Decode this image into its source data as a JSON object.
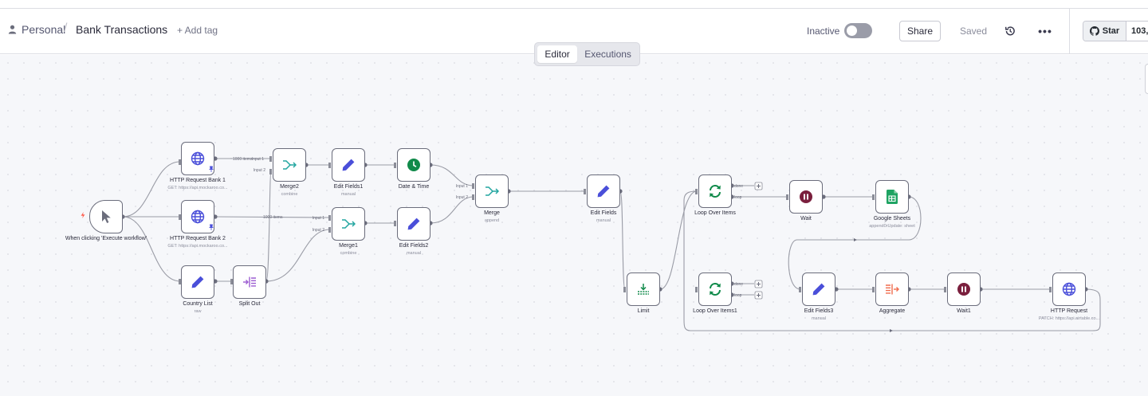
{
  "header": {
    "breadcrumb_personal": "Personal",
    "breadcrumb_sep": "/",
    "workflow_title": "Bank Transactions",
    "add_tag": "+ Add tag",
    "status_label": "Inactive",
    "share_label": "Share",
    "saved_label": "Saved",
    "more_label": "•••",
    "github_star_label": "Star",
    "github_star_count": "103,"
  },
  "tabs": {
    "editor": "Editor",
    "executions": "Executions"
  },
  "colors": {
    "accent_blue": "#4a4fd9",
    "teal": "#23a6a0",
    "green": "#108a4a",
    "sheets_green": "#1ea362",
    "wait_red": "#7a1f3d",
    "aggregate_orange": "#f06b4d",
    "split_purple": "#9b5bd0",
    "trigger_red": "#ff5a4a"
  },
  "nodes": {
    "trigger": {
      "label": "When clicking 'Execute workflow'",
      "icon": "cursor-icon"
    },
    "http1": {
      "label": "HTTP Request Bank 1",
      "sub": "GET: https://api.mockaroo.co...",
      "icon": "globe-icon"
    },
    "http2": {
      "label": "HTTP Request Bank 2",
      "sub": "GET: https://api.mockaroo.co...",
      "icon": "globe-icon"
    },
    "country": {
      "label": "Country List",
      "sub": "raw",
      "icon": "pencil-icon"
    },
    "split": {
      "label": "Split Out",
      "icon": "split-icon"
    },
    "merge2": {
      "label": "Merge2",
      "sub": "combine",
      "icon": "merge-icon"
    },
    "merge1": {
      "label": "Merge1",
      "sub": "combine",
      "icon": "merge-icon"
    },
    "edit1": {
      "label": "Edit Fields1",
      "sub": "manual",
      "icon": "pencil-icon"
    },
    "edit2": {
      "label": "Edit Fields2",
      "sub": "manual",
      "icon": "pencil-icon"
    },
    "datetime": {
      "label": "Date & Time",
      "icon": "clock-icon"
    },
    "merge": {
      "label": "Merge",
      "sub": "append",
      "icon": "merge-icon"
    },
    "edit": {
      "label": "Edit Fields",
      "sub": "manual",
      "icon": "pencil-icon"
    },
    "limit": {
      "label": "Limit",
      "icon": "limit-icon"
    },
    "loop": {
      "label": "Loop Over Items",
      "icon": "loop-icon"
    },
    "loop1": {
      "label": "Loop Over Items1",
      "icon": "loop-icon"
    },
    "wait": {
      "label": "Wait",
      "icon": "pause-icon"
    },
    "sheets": {
      "label": "Google Sheets",
      "sub": "append0rUpdate: sheet",
      "icon": "sheets-icon"
    },
    "edit3": {
      "label": "Edit Fields3",
      "sub": "manual",
      "icon": "pencil-icon"
    },
    "aggregate": {
      "label": "Aggregate",
      "icon": "aggregate-icon"
    },
    "wait1": {
      "label": "Wait1",
      "icon": "pause-icon"
    },
    "httpreq": {
      "label": "HTTP Request",
      "sub": "PATCH: https://api.airtable.co...",
      "icon": "globe-icon"
    }
  },
  "edge_labels": {
    "items_1000_a": "1000 items",
    "input1": "Input 1",
    "input2": "Input 2",
    "items_1000_b": "1000 items",
    "input1_b": "Input 1",
    "input2_b": "Input 2",
    "input1_c": "Input 1",
    "input2_c": "Input 2",
    "done": "done",
    "loop": "loop",
    "done_b": "done",
    "loop_b": "loop"
  }
}
